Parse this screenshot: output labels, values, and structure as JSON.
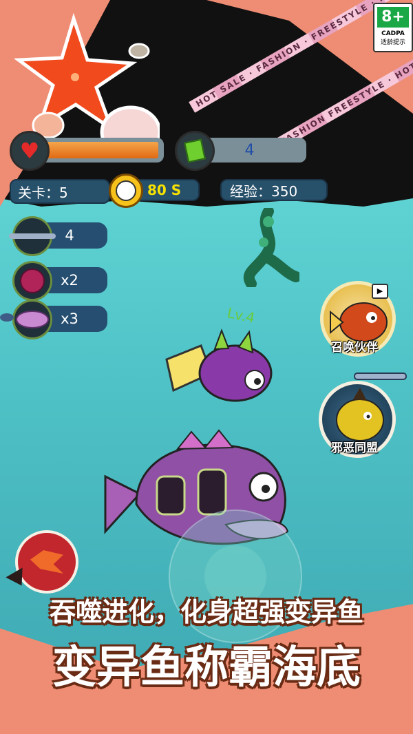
{
  "rating": {
    "age": "8+",
    "org": "CADPA",
    "note": "适龄提示"
  },
  "ribbon": {
    "text1": "HOT SALE · FASHION · FREESTYLE · HOT SALE · FASHION",
    "text2": "FASHION FREESTYLE · HOT SALE · FASHION"
  },
  "hud": {
    "gem_count": "4",
    "level": "关卡：5",
    "timer": "80 S",
    "exp": "经验：350"
  },
  "targets": [
    {
      "count": "4",
      "icon": "needle-fish-icon"
    },
    {
      "count": "x2",
      "icon": "purple-puffer-icon"
    },
    {
      "count": "x3",
      "icon": "pink-fish-icon"
    }
  ],
  "player": {
    "level_label": "Lv.4"
  },
  "skills": [
    {
      "label": "召唤伙伴",
      "icon": "piranha-summon-icon"
    },
    {
      "label": "邪恶同盟",
      "icon": "evil-fish-icon"
    }
  ],
  "banner": {
    "line1": "吞噬进化，化身超强变异鱼",
    "line2": "变异鱼称霸海底"
  },
  "colors": {
    "health": "#f08a2a",
    "sea": "#4fc3c7",
    "accent_yellow": "#f6e100"
  }
}
